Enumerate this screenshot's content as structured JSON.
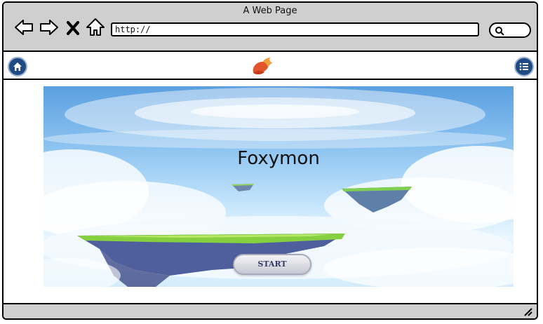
{
  "window": {
    "title": "A Web Page"
  },
  "browser": {
    "url": "http://",
    "icons": [
      "back-arrow-icon",
      "forward-arrow-icon",
      "close-x-icon",
      "home-icon",
      "search-icon"
    ]
  },
  "appbar": {
    "left_icon": "home-icon",
    "center_icon": "fox-logo",
    "right_icon": "menu-list-icon",
    "accent": "#1f4b82"
  },
  "hero": {
    "title": "Foxymon",
    "start_label": "START"
  }
}
